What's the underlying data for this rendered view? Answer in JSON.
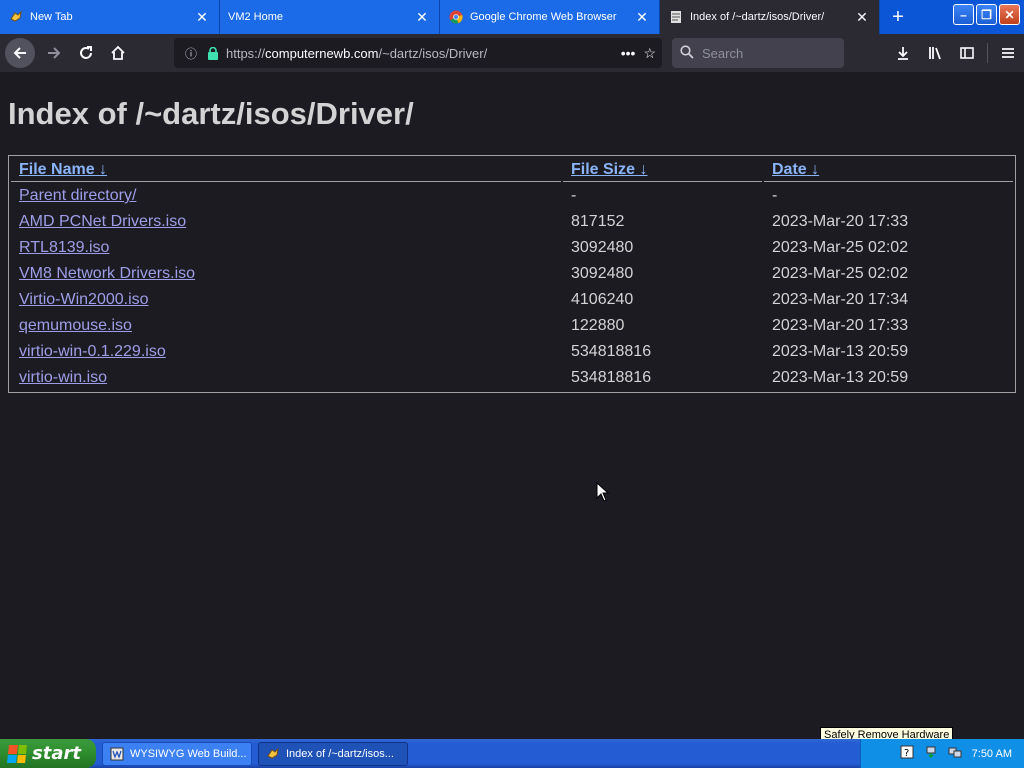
{
  "browser": {
    "tabs": [
      {
        "title": "New Tab",
        "favicon": "chicken-icon",
        "active": false
      },
      {
        "title": "VM2 Home",
        "favicon": "",
        "active": false
      },
      {
        "title": "Google Chrome Web Browser",
        "favicon": "chrome-icon",
        "active": false
      },
      {
        "title": "Index of /~dartz/isos/Driver/",
        "favicon": "page-icon",
        "active": true
      }
    ],
    "url": {
      "scheme": "https://",
      "host": "computernewb.com",
      "path": "/~dartz/isos/Driver/"
    },
    "search_placeholder": "Search"
  },
  "page": {
    "heading": "Index of /~dartz/isos/Driver/",
    "columns": [
      {
        "label": "File Name",
        "sort_arrow": "↓"
      },
      {
        "label": "File Size",
        "sort_arrow": "↓"
      },
      {
        "label": "Date",
        "sort_arrow": "↓"
      }
    ],
    "rows": [
      {
        "name": "Parent directory/",
        "size": "-",
        "date": "-"
      },
      {
        "name": "AMD PCNet Drivers.iso",
        "size": "817152",
        "date": "2023-Mar-20 17:33"
      },
      {
        "name": "RTL8139.iso",
        "size": "3092480",
        "date": "2023-Mar-25 02:02"
      },
      {
        "name": "VM8 Network Drivers.iso",
        "size": "3092480",
        "date": "2023-Mar-25 02:02"
      },
      {
        "name": "Virtio-Win2000.iso",
        "size": "4106240",
        "date": "2023-Mar-20 17:34"
      },
      {
        "name": "qemumouse.iso",
        "size": "122880",
        "date": "2023-Mar-20 17:33"
      },
      {
        "name": "virtio-win-0.1.229.iso",
        "size": "534818816",
        "date": "2023-Mar-13 20:59"
      },
      {
        "name": "virtio-win.iso",
        "size": "534818816",
        "date": "2023-Mar-13 20:59"
      }
    ]
  },
  "taskbar": {
    "start_label": "start",
    "tasks": [
      {
        "label": "WYSIWYG Web Build...",
        "icon": "wysiwyg-icon",
        "active": false
      },
      {
        "label": "Index of /~dartz/isos...",
        "icon": "firefox-icon",
        "active": true
      }
    ],
    "tooltip": "Safely Remove Hardware",
    "clock": "7:50 AM"
  },
  "colors": {
    "tab_strip": "#0a56d6",
    "page_bg": "#1c1b22",
    "link": "#8ab4f8",
    "visited_link": "#9e9ee8"
  }
}
